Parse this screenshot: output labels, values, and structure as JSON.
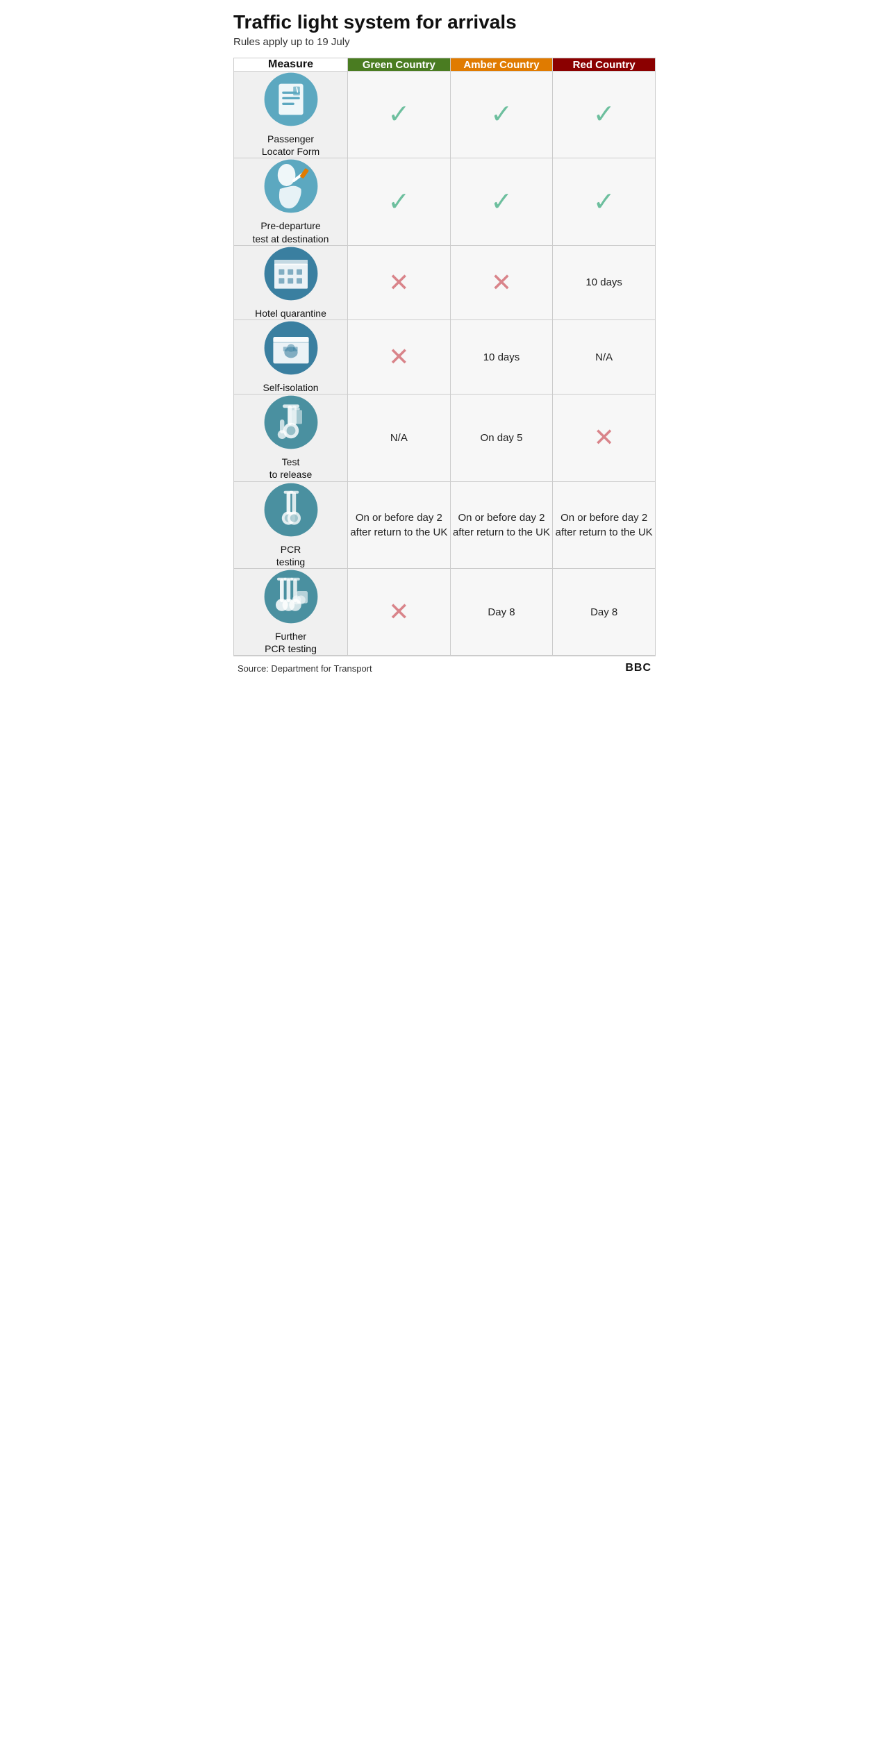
{
  "title": "Traffic light system for arrivals",
  "subtitle": "Rules apply up to 19 July",
  "columns": {
    "measure_header": "Measure",
    "green_header": "Green Country",
    "amber_header": "Amber Country",
    "red_header": "Red Country"
  },
  "rows": [
    {
      "id": "passenger-locator",
      "label": "Passenger\nLocator Form",
      "green": "check",
      "amber": "check",
      "red": "check"
    },
    {
      "id": "pre-departure",
      "label": "Pre-departure\ntest at destination",
      "green": "check",
      "amber": "check",
      "red": "check"
    },
    {
      "id": "hotel-quarantine",
      "label": "Hotel quarantine",
      "green": "cross",
      "amber": "cross",
      "red": "10 days"
    },
    {
      "id": "self-isolation",
      "label": "Self-isolation",
      "green": "cross",
      "amber": "10 days",
      "red": "N/A"
    },
    {
      "id": "test-to-release",
      "label": "Test\nto release",
      "green": "N/A",
      "amber": "On day 5",
      "red": "cross"
    },
    {
      "id": "pcr-testing",
      "label": "PCR\ntesting",
      "green": "On or before day 2 after return to the UK",
      "amber": "On or before day 2 after return to the UK",
      "red": "On or before day 2 after return to the UK"
    },
    {
      "id": "further-pcr",
      "label": "Further\nPCR testing",
      "green": "cross",
      "amber": "Day 8",
      "red": "Day 8"
    }
  ],
  "footer": {
    "source": "Source: Department for Transport",
    "logo": "BBC"
  },
  "colors": {
    "green": "#4a7c21",
    "amber": "#e07b00",
    "red": "#8b0000",
    "check": "#6dbf9e",
    "cross": "#d9848a"
  }
}
